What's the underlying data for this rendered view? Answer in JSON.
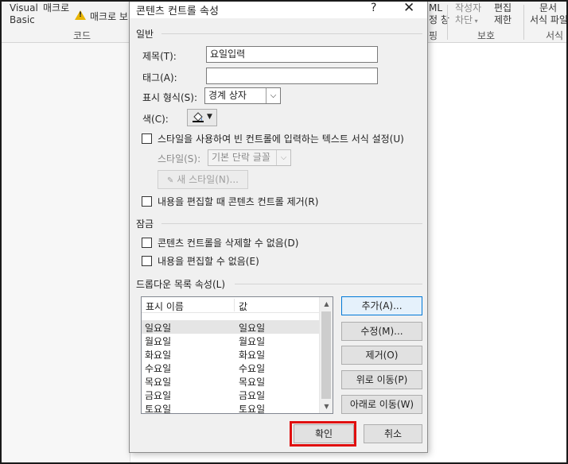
{
  "ribbon": {
    "visual_basic_line1": "Visual",
    "visual_basic_line2": "Basic",
    "macro": "매크로",
    "macro_security": "매크로 보",
    "code_group": "코드",
    "xml_line1": "ML",
    "xml_line2": "정 창",
    "mapping": "핑",
    "block_authors_line1": "작성자",
    "block_authors_line2": "차단",
    "restrict_line1": "편집",
    "restrict_line2": "제한",
    "protect_group": "보호",
    "doc_template_line1": "문서",
    "doc_template_line2": "서식 파일",
    "template_group": "서식"
  },
  "dialog": {
    "title": "콘텐츠 컨트롤 속성",
    "help": "?",
    "close": "✕",
    "general_section": "일반",
    "title_label": "제목(T):",
    "title_value": "요일입력",
    "tag_label": "태그(A):",
    "tag_value": "",
    "display_label": "표시 형식(S):",
    "display_value": "경계 상자",
    "color_label": "색(C):",
    "use_style_label": "스타일을 사용하여 빈 컨트롤에 입력하는 텍스트 서식 설정(U)",
    "style_label": "스타일(S):",
    "style_value": "기본 단락 글꼴",
    "new_style_button": "새 스타일(N)...",
    "remove_when_edited": "내용을 편집할 때 콘텐츠 컨트롤 제거(R)",
    "lock_section": "잠금",
    "cannot_delete": "콘텐츠 컨트롤을 삭제할 수 없음(D)",
    "cannot_edit": "내용을 편집할 수 없음(E)",
    "dropdown_section": "드롭다운 목록 속성(L)",
    "col_display": "표시 이름",
    "col_value": "값",
    "items": [
      {
        "display": "일요일",
        "value": "일요일"
      },
      {
        "display": "월요일",
        "value": "월요일"
      },
      {
        "display": "화요일",
        "value": "화요일"
      },
      {
        "display": "수요일",
        "value": "수요일"
      },
      {
        "display": "목요일",
        "value": "목요일"
      },
      {
        "display": "금요일",
        "value": "금요일"
      },
      {
        "display": "토요일",
        "value": "토요일"
      }
    ],
    "add_button": "추가(A)...",
    "modify_button": "수정(M)...",
    "remove_button": "제거(O)",
    "move_up_button": "위로 이동(P)",
    "move_down_button": "아래로 이동(W)",
    "ok_button": "확인",
    "cancel_button": "취소"
  },
  "colors": {
    "highlight_box": "#e01010",
    "focus_blue": "#0078d7"
  }
}
